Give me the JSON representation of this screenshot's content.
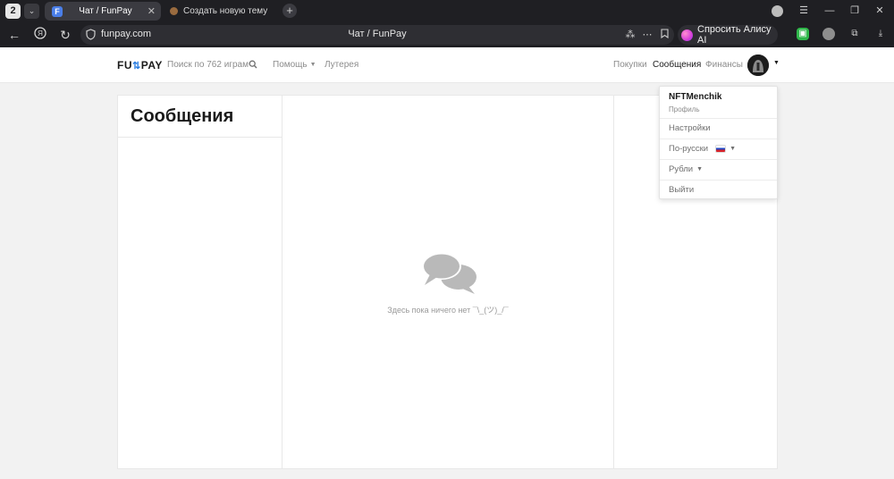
{
  "browser": {
    "tab_count": "2",
    "tabs": [
      {
        "title": "Чат / FunPay",
        "favicon": "F",
        "active": true
      },
      {
        "title": "Создать новую тему - Rea",
        "active": false
      }
    ],
    "new_tab_label": "+",
    "url": "funpay.com",
    "page_title": "Чат / FunPay",
    "alice_button": "Спросить Алису AI"
  },
  "header": {
    "logo_left": "FU",
    "logo_arrow": "⇅",
    "logo_right": "PAY",
    "search_placeholder": "Поиск по 762 играм",
    "help_label": "Помощь",
    "lottery_label": "Лутерея",
    "purchases_label": "Покупки",
    "messages_label": "Сообщения",
    "finances_label": "Финансы"
  },
  "chat": {
    "title": "Сообщения",
    "empty_text": "Здесь пока ничего нет ¯\\_(ツ)_/¯"
  },
  "dropdown": {
    "username": "NFTMenchik",
    "profile_label": "Профиль",
    "settings_label": "Настройки",
    "language_label": "По-русски",
    "currency_label": "Рубли",
    "logout_label": "Выйти"
  },
  "colors": {
    "browser_chrome": "#1f1f23",
    "page_bg": "#f2f2f2",
    "card_bg": "#ffffff",
    "logo_accent": "#2a7de1",
    "empty_icon": "#b9b9b9"
  }
}
